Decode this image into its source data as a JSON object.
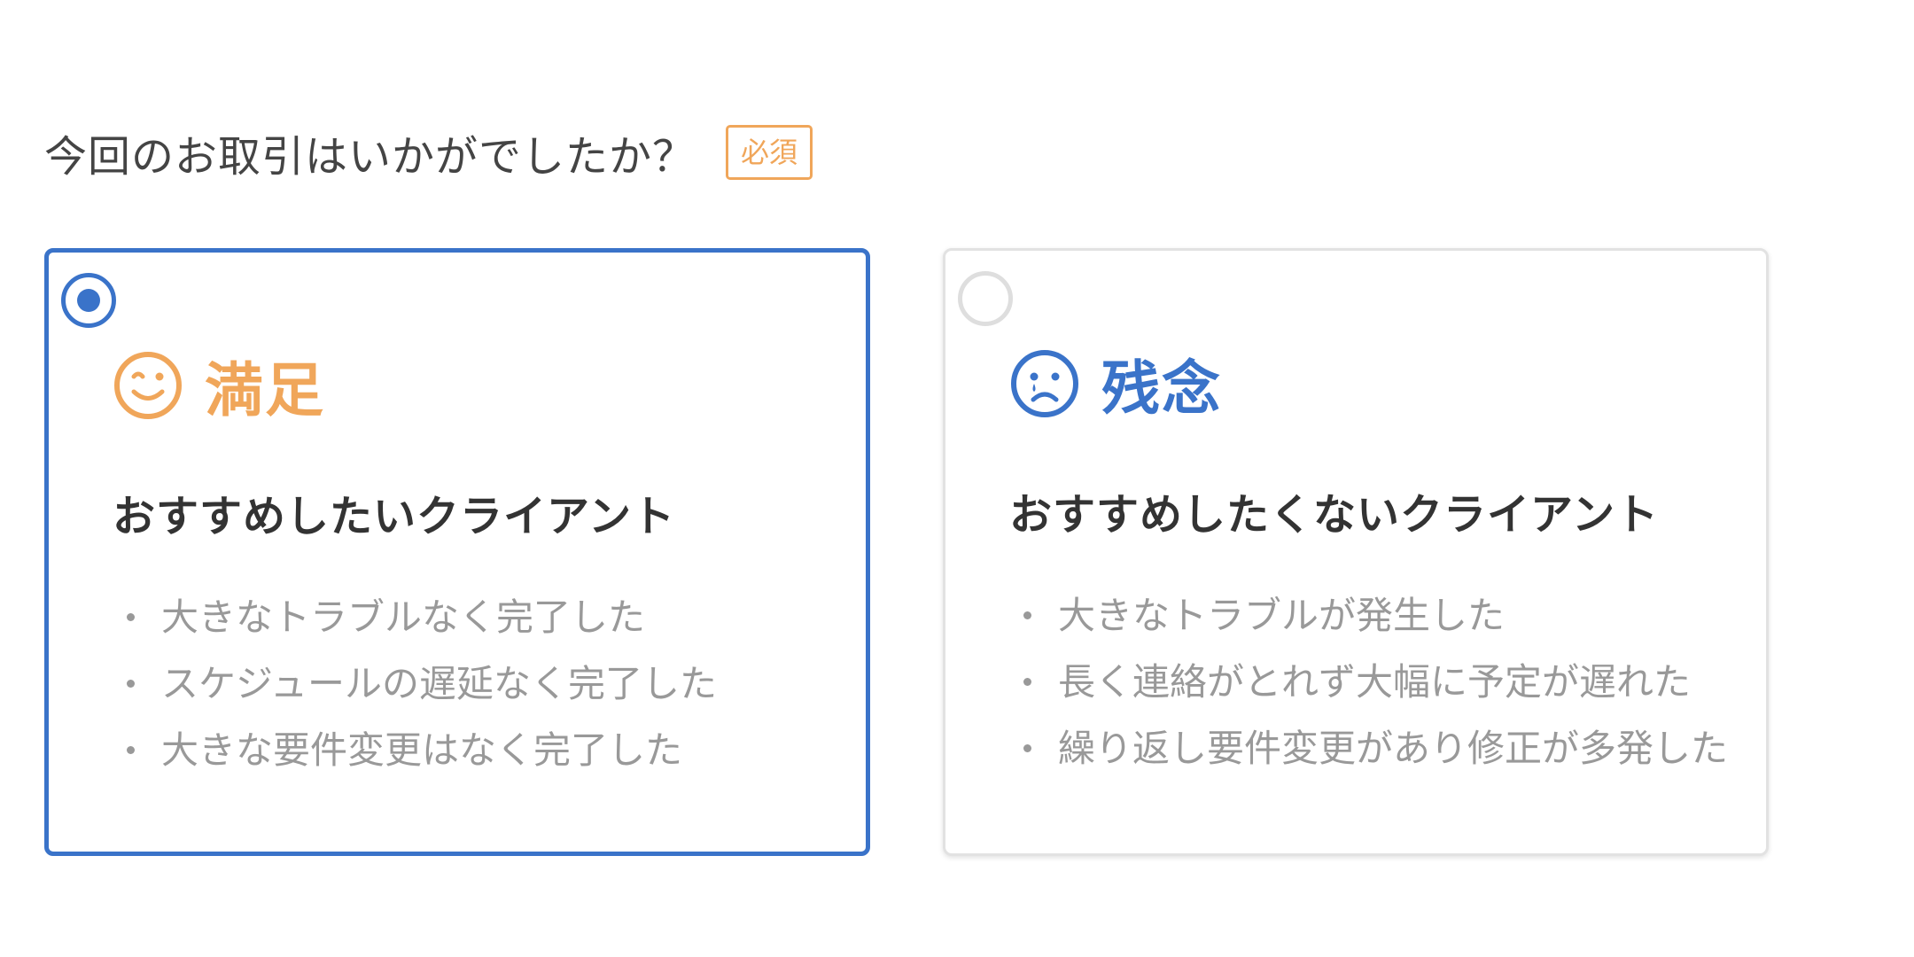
{
  "question": {
    "text": "今回のお取引はいかがでしたか？",
    "required_label": "必須"
  },
  "options": [
    {
      "selected": true,
      "icon": "smile-icon",
      "label": "満足",
      "heading": "おすすめしたいクライアント",
      "points": [
        "大きなトラブルなく完了した",
        "スケジュールの遅延なく完了した",
        "大きな要件変更はなく完了した"
      ]
    },
    {
      "selected": false,
      "icon": "sad-face-icon",
      "label": "残念",
      "heading": "おすすめしたくないクライアント",
      "points": [
        "大きなトラブルが発生した",
        "長く連絡がとれず大幅に予定が遅れた",
        "繰り返し要件変更があり修正が多発した"
      ]
    }
  ],
  "colors": {
    "accent_blue": "#3a73c9",
    "accent_orange": "#f0a65a",
    "muted_text": "#999999",
    "heading_text": "#333333"
  }
}
